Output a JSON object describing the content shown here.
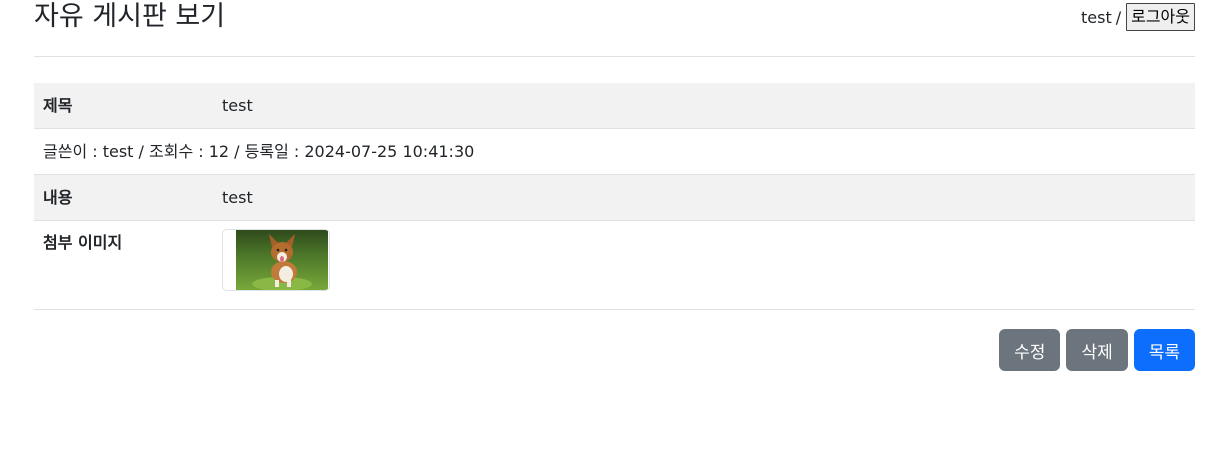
{
  "header": {
    "title": "자유 게시판 보기",
    "username": "test",
    "separator": "/",
    "logout_label": "로그아웃"
  },
  "post": {
    "title_label": "제목",
    "title_value": "test",
    "meta": "글쓴이 : test / 조회수 : 12 / 등록일 : 2024-07-25 10:41:30",
    "content_label": "내용",
    "content_value": "test",
    "image_label": "첨부 이미지",
    "image_icon": "dog-photo-thumbnail"
  },
  "actions": {
    "edit_label": "수정",
    "delete_label": "삭제",
    "list_label": "목록"
  },
  "colors": {
    "secondary": "#6c757d",
    "primary": "#0d6efd",
    "row_shade": "#f2f2f2"
  }
}
